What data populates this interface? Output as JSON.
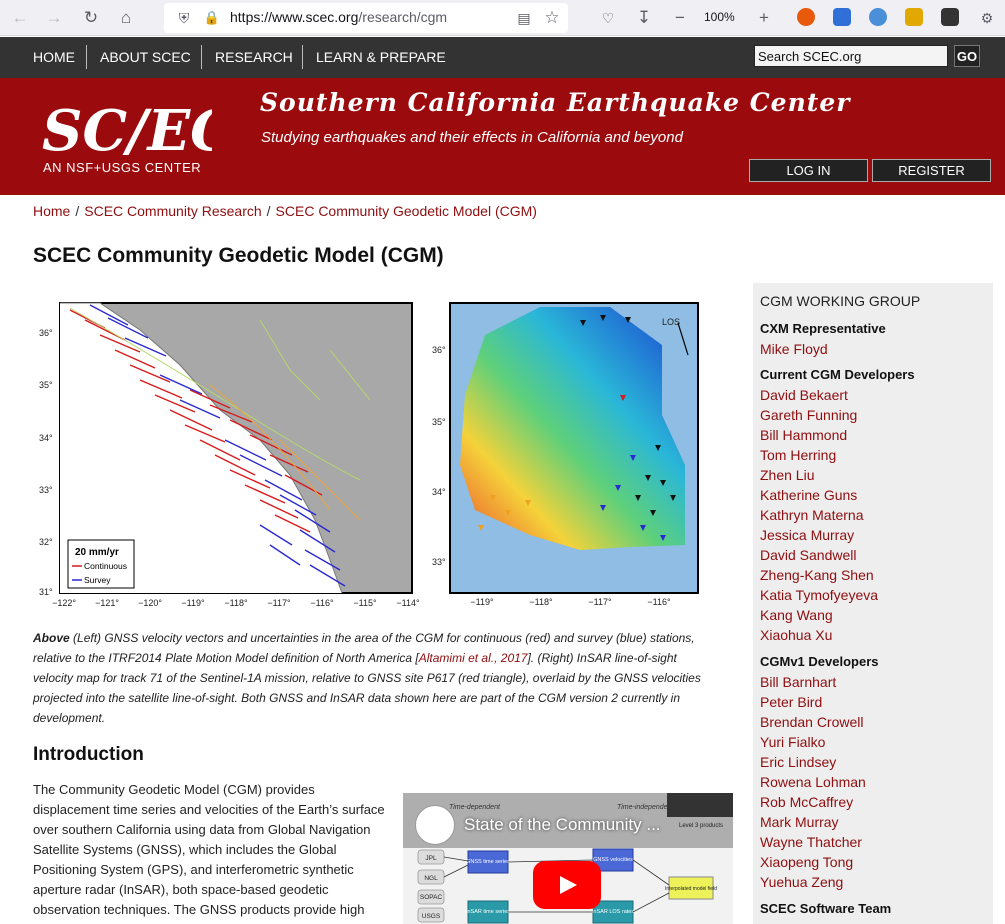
{
  "browser": {
    "url_host": "https://www.scec.org",
    "url_path": "/research/cgm",
    "zoom": "100%"
  },
  "nav": {
    "items": [
      "HOME",
      "ABOUT SCEC",
      "RESEARCH",
      "LEARN & PREPARE"
    ],
    "search_placeholder": "Search SCEC.org",
    "search_button": "GO"
  },
  "header": {
    "logo_text": "SC/EC",
    "logo_sub": "AN NSF+USGS CENTER",
    "title": "Southern California Earthquake Center",
    "tagline": "Studying earthquakes and their effects in California and beyond",
    "login": "LOG IN",
    "register": "REGISTER"
  },
  "breadcrumb": [
    "Home",
    "SCEC Community Research",
    "SCEC Community Geodetic Model (CGM)"
  ],
  "page_title": "SCEC Community Geodetic Model (CGM)",
  "figure_left": {
    "lat_ticks": [
      "36°",
      "35°",
      "34°",
      "33°",
      "32°",
      "31°"
    ],
    "lon_ticks": [
      "−122°",
      "−121°",
      "−120°",
      "−119°",
      "−118°",
      "−117°",
      "−116°",
      "−115°",
      "−114°"
    ],
    "legend_title": "20 mm/yr",
    "legend_continuous": "Continuous",
    "legend_survey": "Survey"
  },
  "figure_right": {
    "lat_ticks": [
      "36°",
      "35°",
      "34°",
      "33°"
    ],
    "lon_ticks": [
      "−119°",
      "−118°",
      "−117°",
      "−116°"
    ],
    "los_label": "LOS"
  },
  "caption": {
    "lead": "Above",
    "text1": " (Left) GNSS velocity vectors and uncertainties in the area of the CGM for continuous (red) and survey (blue) stations, relative to the ITRF2014 Plate Motion Model definition of North America [",
    "link": "Altamimi et al., 2017",
    "text2": "]. (Right) InSAR line-of-sight velocity map for track 71 of the Sentinel-1A mission, relative to GNSS site P617 (red triangle), overlaid by the GNSS velocities projected into the satellite line-of-sight. Both GNSS and InSAR data shown here are part of the CGM version 2 currently in development."
  },
  "intro": {
    "heading": "Introduction",
    "text": "The Community Geodetic Model (CGM) provides displacement time series and velocities of the Earth’s surface over southern California using data from Global Navigation Satellite Systems (GNSS), which includes the Global Positioning System (GPS), and interferometric synthetic aperture radar (InSAR), both space-based geodetic observation techniques. The GNSS products provide high"
  },
  "video": {
    "title": "State of the Community ...",
    "label_time_dep": "Time-dependent",
    "label_time_indep": "Time-independent",
    "label_level3": "Level 3 products",
    "boxes": [
      "JPL",
      "NGL",
      "SOPAC",
      "USGS",
      "GNSS time series",
      "GNSS velocities",
      "InSAR time series",
      "InSAR LOS rates",
      "Interpolated model field"
    ]
  },
  "sidebar": {
    "heading": "CGM WORKING GROUP",
    "sections": [
      {
        "title": "CXM Representative",
        "people": [
          "Mike Floyd"
        ]
      },
      {
        "title": "Current CGM Developers",
        "people": [
          "David Bekaert",
          "Gareth Funning",
          "Bill Hammond",
          "Tom Herring",
          "Zhen Liu",
          "Katherine Guns",
          "Kathryn Materna",
          "Jessica Murray",
          "David Sandwell",
          "Zheng-Kang Shen",
          "Katia Tymofyeyeva",
          "Kang Wang",
          "Xiaohua Xu"
        ]
      },
      {
        "title": "CGMv1 Developers",
        "people": [
          "Bill Barnhart",
          "Peter Bird",
          "Brendan Crowell",
          "Yuri Fialko",
          "Eric Lindsey",
          "Rowena Lohman",
          "Rob McCaffrey",
          "Mark Murray",
          "Wayne Thatcher",
          "Xiaopeng Tong",
          "Yuehua Zeng"
        ]
      },
      {
        "title": "SCEC Software Team",
        "people": []
      }
    ]
  }
}
